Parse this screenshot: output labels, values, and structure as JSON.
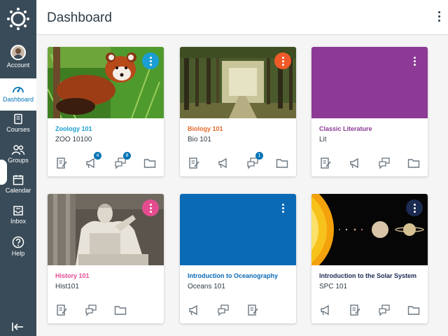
{
  "header": {
    "title": "Dashboard"
  },
  "nav": {
    "account": "Account",
    "dashboard": "Dashboard",
    "courses": "Courses",
    "groups": "Groups",
    "calendar": "Calendar",
    "inbox": "Inbox",
    "help": "Help"
  },
  "colors": {
    "nav_bg": "#394b58",
    "accent": "#0374b5",
    "zoology": "#1a9ed4",
    "biology": "#f05a28",
    "literature": "#8c3a96",
    "history": "#e54c90",
    "oceanography": "#0a6ab6",
    "solar": "#1c2b52"
  },
  "cards": [
    {
      "name": "Zoology 101",
      "code": "ZOO 10100",
      "image": "red-panda-photo",
      "badges": {
        "announcements": "4",
        "discussions": "8"
      }
    },
    {
      "name": "Biology 101",
      "code": "Bio 101",
      "image": "forest-path-photo",
      "badges": {
        "discussions": "1"
      }
    },
    {
      "name": "Classic Literature",
      "code": "Lit",
      "image": "solid-purple"
    },
    {
      "name": "History 101",
      "code": "Hist101",
      "image": "lincoln-memorial-photo"
    },
    {
      "name": "Introduction to Oceanography",
      "code": "Oceans 101",
      "image": "solid-blue"
    },
    {
      "name": "Introduction to the Solar System",
      "code": "SPC 101",
      "image": "sun-and-planets-photo"
    }
  ]
}
